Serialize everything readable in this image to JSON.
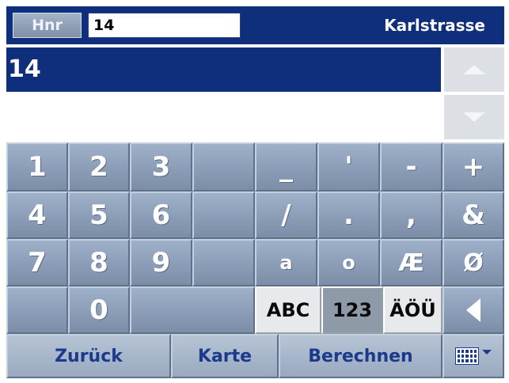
{
  "header": {
    "hnr_label": "Hnr",
    "input_value": "14",
    "street": "Karlstrasse"
  },
  "list": {
    "items": [
      "14"
    ]
  },
  "keys": {
    "row1": [
      "1",
      "2",
      "3",
      "",
      "_",
      "'",
      "-",
      "+"
    ],
    "row2": [
      "4",
      "5",
      "6",
      "",
      "/",
      ".",
      ",",
      "&"
    ],
    "row3": [
      "7",
      "8",
      "9",
      "",
      "a",
      "o",
      "Æ",
      "Ø"
    ],
    "row4": [
      "",
      "0",
      "",
      "ABC",
      "123",
      "ÄÖÜ"
    ]
  },
  "bottom": {
    "back": "Zurück",
    "map": "Karte",
    "calculate": "Berechnen"
  },
  "colors": {
    "header": "#0f2f7c",
    "key": "#8ea0b8",
    "bottom_text": "#1b3a8c"
  }
}
